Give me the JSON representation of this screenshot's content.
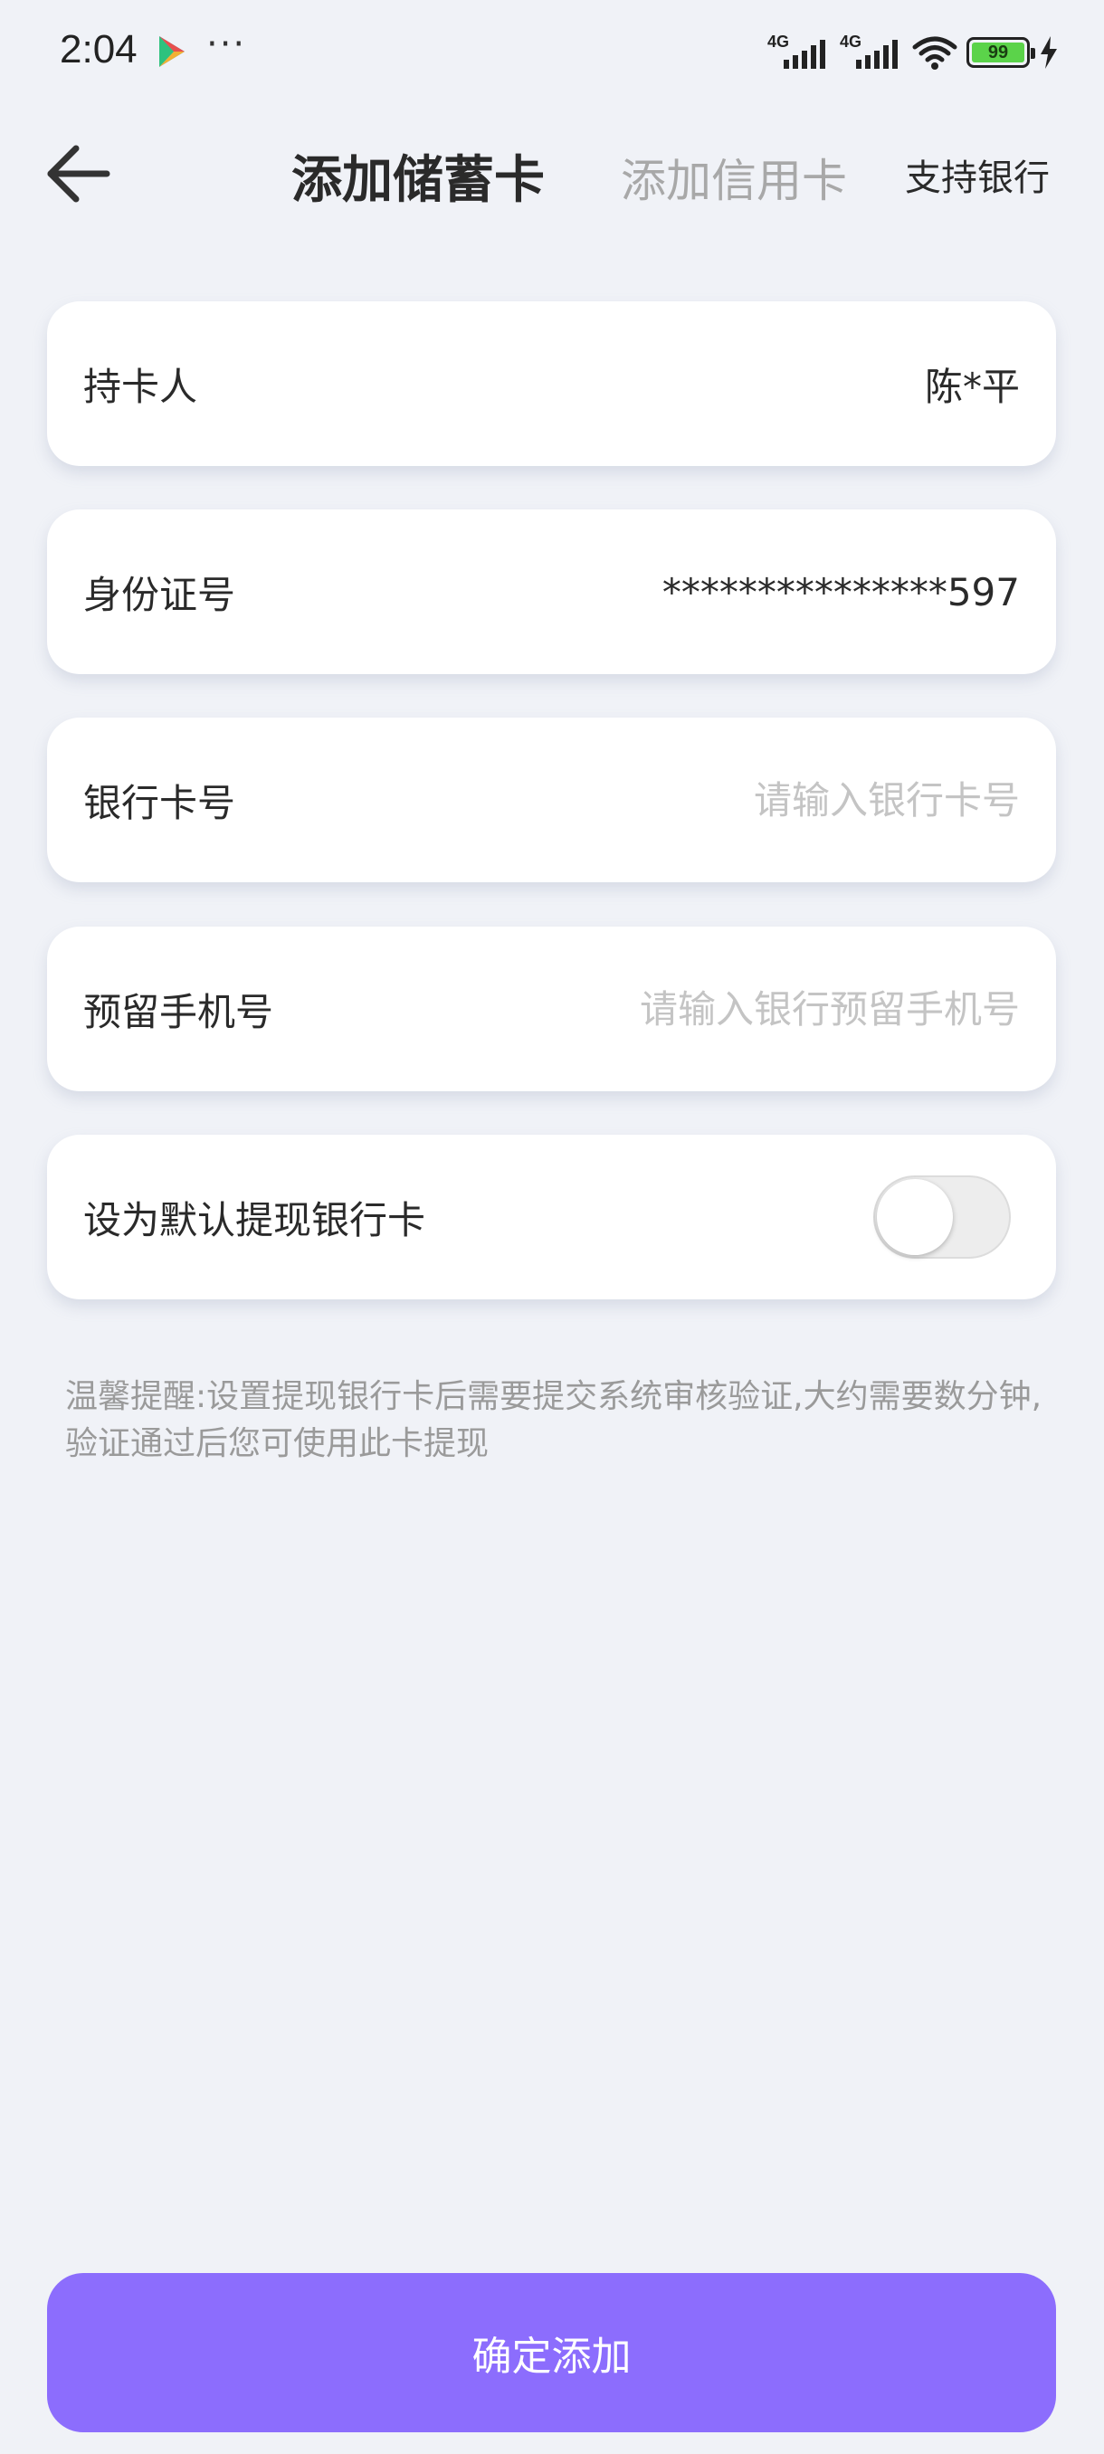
{
  "status_bar": {
    "time": "2:04",
    "network_1": "4G",
    "network_2": "4G",
    "battery": "99",
    "icons": [
      "play-store-icon",
      "more-dots-icon",
      "signal-icon",
      "wifi-icon",
      "battery-icon",
      "charging-icon"
    ]
  },
  "header": {
    "back_icon": "arrow-left-icon",
    "tab_debit": "添加储蓄卡",
    "tab_credit": "添加信用卡",
    "support_banks": "支持银行"
  },
  "form": {
    "holder_label": "持卡人",
    "holder_value": "陈*平",
    "id_label": "身份证号",
    "id_value": "***************597",
    "card_label": "银行卡号",
    "card_placeholder": "请输入银行卡号",
    "phone_label": "预留手机号",
    "phone_placeholder": "请输入银行预留手机号",
    "default_label": "设为默认提现银行卡",
    "default_on": false
  },
  "tip": "温馨提醒:设置提现银行卡后需要提交系统审核验证,大约需要数分钟,验证通过后您可使用此卡提现",
  "confirm_button": "确定添加",
  "colors": {
    "background": "#f0f2f7",
    "accent": "#8c6dfd",
    "placeholder": "#c4c4c4",
    "inactive_tab": "#a8a8a8"
  }
}
